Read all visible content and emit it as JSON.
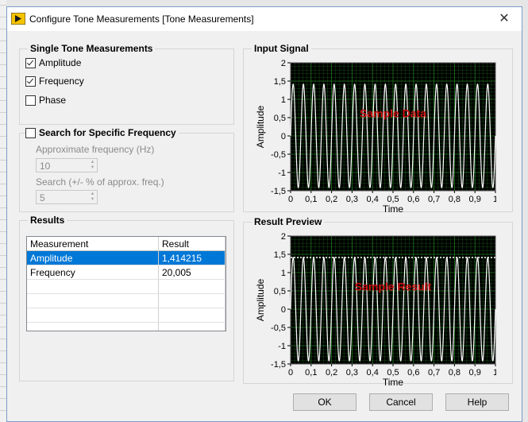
{
  "window": {
    "title": "Configure Tone Measurements [Tone Measurements]"
  },
  "single_tone": {
    "title": "Single Tone Measurements",
    "options": [
      {
        "label": "Amplitude",
        "checked": true
      },
      {
        "label": "Frequency",
        "checked": true
      },
      {
        "label": "Phase",
        "checked": false
      }
    ]
  },
  "search": {
    "label": "Search for Specific Frequency",
    "checked": false,
    "approx_label": "Approximate frequency (Hz)",
    "approx_value": "10",
    "range_label": "Search (+/- % of approx. freq.)",
    "range_value": "5"
  },
  "results": {
    "title": "Results",
    "columns": [
      "Measurement",
      "Result"
    ],
    "rows": [
      {
        "measurement": "Amplitude",
        "result": "1,414215"
      },
      {
        "measurement": "Frequency",
        "result": "20,005"
      }
    ]
  },
  "input_signal": {
    "title": "Input Signal",
    "overlay": "Sample Data",
    "xlabel": "Time",
    "ylabel": "Amplitude"
  },
  "result_preview": {
    "title": "Result Preview",
    "overlay": "Sample Result",
    "xlabel": "Time",
    "ylabel": "Amplitude"
  },
  "buttons": {
    "ok": "OK",
    "cancel": "Cancel",
    "help": "Help"
  },
  "chart_data": [
    {
      "type": "line",
      "title": "Input Signal",
      "xlabel": "Time",
      "ylabel": "Amplitude",
      "xlim": [
        0,
        1
      ],
      "ylim": [
        -1.5,
        2
      ],
      "x_ticks": [
        "0",
        "0,1",
        "0,2",
        "0,3",
        "0,4",
        "0,5",
        "0,6",
        "0,7",
        "0,8",
        "0,9",
        "1"
      ],
      "y_ticks": [
        "2",
        "1,5",
        "1",
        "0,5",
        "0",
        "-0,5",
        "-1",
        "-1,5"
      ],
      "series": [
        {
          "frequency_hz": 20,
          "amplitude": 1.414,
          "color": "#ffffff"
        }
      ],
      "grid": true
    },
    {
      "type": "line",
      "title": "Result Preview",
      "xlabel": "Time",
      "ylabel": "Amplitude",
      "xlim": [
        0,
        1
      ],
      "ylim": [
        -1.5,
        2
      ],
      "x_ticks": [
        "0",
        "0,1",
        "0,2",
        "0,3",
        "0,4",
        "0,5",
        "0,6",
        "0,7",
        "0,8",
        "0,9",
        "1"
      ],
      "y_ticks": [
        "2",
        "1,5",
        "1",
        "0,5",
        "0",
        "-0,5",
        "-1",
        "-1,5"
      ],
      "series": [
        {
          "frequency_hz": 20,
          "amplitude": 1.414,
          "color": "#ffffff"
        },
        {
          "type": "dotted-level",
          "value": 1.414,
          "color": "#ffffff"
        }
      ],
      "grid": true
    }
  ],
  "colors": {
    "plot_bg": "#000000",
    "grid": "#1f7a1f",
    "overlay_text": "#cc1111",
    "selection": "#0078d7"
  }
}
